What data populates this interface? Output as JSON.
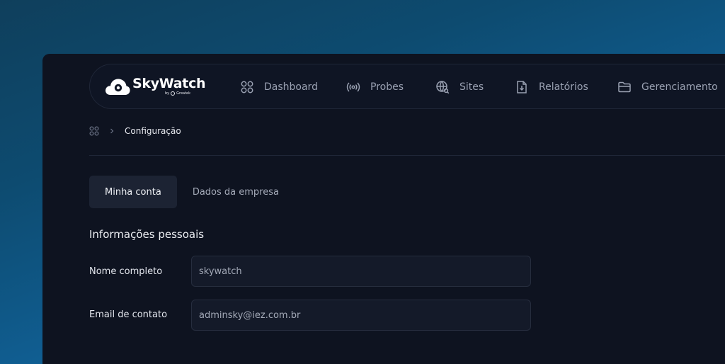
{
  "app": {
    "name": "SkyWatch",
    "byline": "by",
    "byline_brand": "Greatek"
  },
  "nav": {
    "items": [
      {
        "label": "Dashboard",
        "icon": "grid-icon"
      },
      {
        "label": "Probes",
        "icon": "broadcast-icon"
      },
      {
        "label": "Sites",
        "icon": "globe-icon"
      },
      {
        "label": "Relatórios",
        "icon": "file-download-icon"
      },
      {
        "label": "Gerenciamento",
        "icon": "folder-icon"
      }
    ]
  },
  "breadcrumb": {
    "current": "Configuração"
  },
  "tabs": [
    {
      "label": "Minha conta",
      "active": true
    },
    {
      "label": "Dados da empresa",
      "active": false
    }
  ],
  "personal": {
    "title": "Informações pessoais",
    "fields": [
      {
        "label": "Nome completo",
        "value": "skywatch"
      },
      {
        "label": "Email de contato",
        "value": "adminsky@iez.com.br"
      }
    ]
  }
}
